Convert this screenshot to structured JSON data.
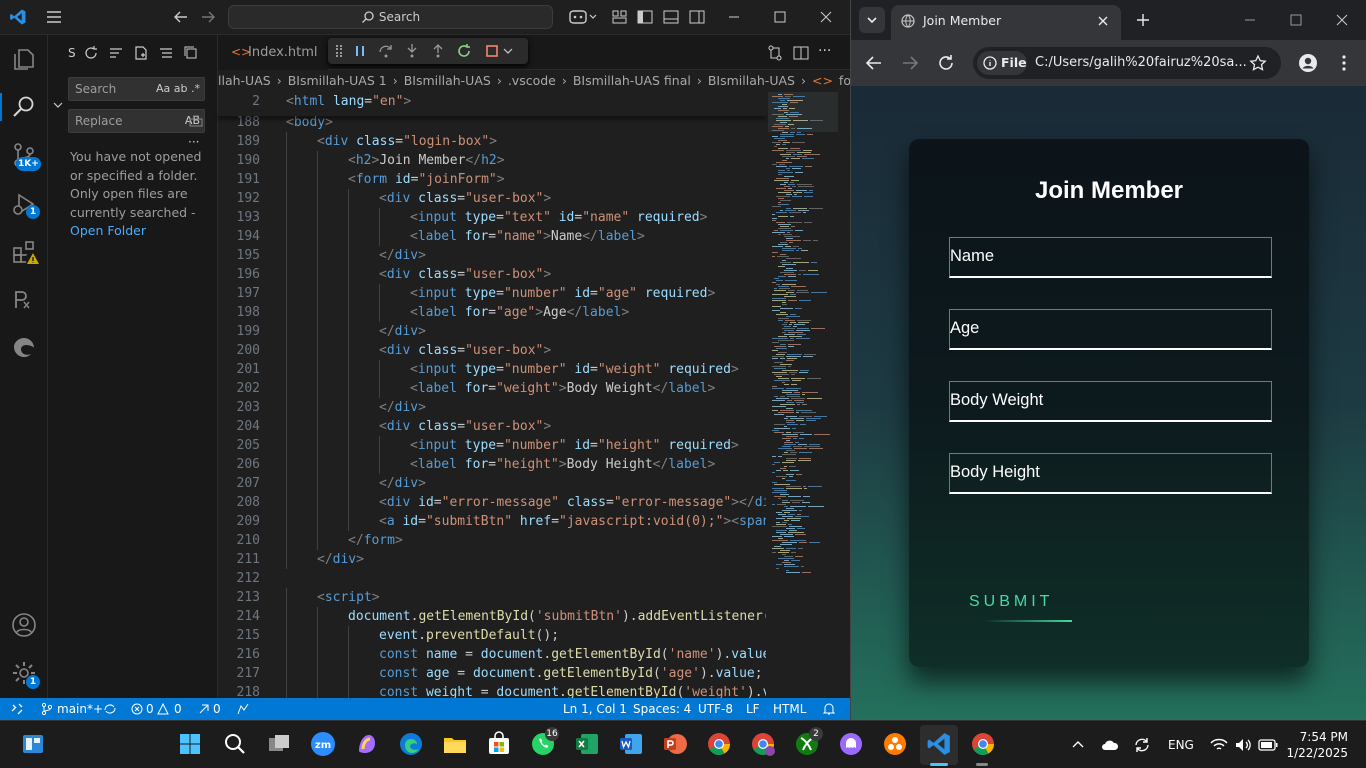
{
  "vscode": {
    "search_label": "Search",
    "sidebar": {
      "title_initial": "S",
      "search_placeholder": "Search",
      "search_opts": "Aa ab .*",
      "replace_placeholder": "Replace",
      "replace_opts": "AB",
      "message": "You have not opened or specified a folder. Only open files are currently searched -",
      "open_folder": "Open Folder"
    },
    "activity": {
      "scm_badge": "1K+",
      "debug_badge": "1",
      "settings_badge": "1"
    },
    "tabs": {
      "index": "Index.html"
    },
    "breadcrumb": [
      "llah-UAS",
      "BIsmillah-UAS 1",
      "BIsmillah-UAS",
      ".vscode",
      "BIsmillah-UAS final",
      "BIsmillah-UAS",
      "form.html"
    ],
    "code_lines": [
      {
        "n": "2",
        "html": "<span class=\"br\">&lt;</span><span class=\"tg\">html</span> <span class=\"at\">lang</span><span class=\"pl\">=</span><span class=\"st\">\"en\"</span><span class=\"br\">&gt;</span>",
        "indent": 0
      },
      {
        "n": "188",
        "html": "<span class=\"br\">&lt;</span><span class=\"tg\">body</span><span class=\"br\">&gt;</span>",
        "indent": 0
      },
      {
        "n": "189",
        "html": "<span class=\"br\">&lt;</span><span class=\"tg\">div</span> <span class=\"at\">class</span><span class=\"pl\">=</span><span class=\"st\">\"login-box\"</span><span class=\"br\">&gt;</span>",
        "indent": 1
      },
      {
        "n": "190",
        "html": "<span class=\"br\">&lt;</span><span class=\"tg\">h2</span><span class=\"br\">&gt;</span><span class=\"pl\">Join Member</span><span class=\"br\">&lt;/</span><span class=\"tg\">h2</span><span class=\"br\">&gt;</span>",
        "indent": 2
      },
      {
        "n": "191",
        "html": "<span class=\"br\">&lt;</span><span class=\"tg\">form</span> <span class=\"at\">id</span><span class=\"pl\">=</span><span class=\"st\">\"joinForm\"</span><span class=\"br\">&gt;</span>",
        "indent": 2
      },
      {
        "n": "192",
        "html": "<span class=\"br\">&lt;</span><span class=\"tg\">div</span> <span class=\"at\">class</span><span class=\"pl\">=</span><span class=\"st\">\"user-box\"</span><span class=\"br\">&gt;</span>",
        "indent": 3
      },
      {
        "n": "193",
        "html": "<span class=\"br\">&lt;</span><span class=\"tg\">input</span> <span class=\"at\">type</span><span class=\"pl\">=</span><span class=\"st\">\"text\"</span> <span class=\"at\">id</span><span class=\"pl\">=</span><span class=\"st\">\"name\"</span> <span class=\"at\">required</span><span class=\"br\">&gt;</span>",
        "indent": 4
      },
      {
        "n": "194",
        "html": "<span class=\"br\">&lt;</span><span class=\"tg\">label</span> <span class=\"at\">for</span><span class=\"pl\">=</span><span class=\"st\">\"name\"</span><span class=\"br\">&gt;</span><span class=\"pl\">Name</span><span class=\"br\">&lt;/</span><span class=\"tg\">label</span><span class=\"br\">&gt;</span>",
        "indent": 4
      },
      {
        "n": "195",
        "html": "<span class=\"br\">&lt;/</span><span class=\"tg\">div</span><span class=\"br\">&gt;</span>",
        "indent": 3
      },
      {
        "n": "196",
        "html": "<span class=\"br\">&lt;</span><span class=\"tg\">div</span> <span class=\"at\">class</span><span class=\"pl\">=</span><span class=\"st\">\"user-box\"</span><span class=\"br\">&gt;</span>",
        "indent": 3
      },
      {
        "n": "197",
        "html": "<span class=\"br\">&lt;</span><span class=\"tg\">input</span> <span class=\"at\">type</span><span class=\"pl\">=</span><span class=\"st\">\"number\"</span> <span class=\"at\">id</span><span class=\"pl\">=</span><span class=\"st\">\"age\"</span> <span class=\"at\">required</span><span class=\"br\">&gt;</span>",
        "indent": 4
      },
      {
        "n": "198",
        "html": "<span class=\"br\">&lt;</span><span class=\"tg\">label</span> <span class=\"at\">for</span><span class=\"pl\">=</span><span class=\"st\">\"age\"</span><span class=\"br\">&gt;</span><span class=\"pl\">Age</span><span class=\"br\">&lt;/</span><span class=\"tg\">label</span><span class=\"br\">&gt;</span>",
        "indent": 4
      },
      {
        "n": "199",
        "html": "<span class=\"br\">&lt;/</span><span class=\"tg\">div</span><span class=\"br\">&gt;</span>",
        "indent": 3
      },
      {
        "n": "200",
        "html": "<span class=\"br\">&lt;</span><span class=\"tg\">div</span> <span class=\"at\">class</span><span class=\"pl\">=</span><span class=\"st\">\"user-box\"</span><span class=\"br\">&gt;</span>",
        "indent": 3
      },
      {
        "n": "201",
        "html": "<span class=\"br\">&lt;</span><span class=\"tg\">input</span> <span class=\"at\">type</span><span class=\"pl\">=</span><span class=\"st\">\"number\"</span> <span class=\"at\">id</span><span class=\"pl\">=</span><span class=\"st\">\"weight\"</span> <span class=\"at\">required</span><span class=\"br\">&gt;</span>",
        "indent": 4
      },
      {
        "n": "202",
        "html": "<span class=\"br\">&lt;</span><span class=\"tg\">label</span> <span class=\"at\">for</span><span class=\"pl\">=</span><span class=\"st\">\"weight\"</span><span class=\"br\">&gt;</span><span class=\"pl\">Body Weight</span><span class=\"br\">&lt;/</span><span class=\"tg\">label</span><span class=\"br\">&gt;</span>",
        "indent": 4
      },
      {
        "n": "203",
        "html": "<span class=\"br\">&lt;/</span><span class=\"tg\">div</span><span class=\"br\">&gt;</span>",
        "indent": 3
      },
      {
        "n": "204",
        "html": "<span class=\"br\">&lt;</span><span class=\"tg\">div</span> <span class=\"at\">class</span><span class=\"pl\">=</span><span class=\"st\">\"user-box\"</span><span class=\"br\">&gt;</span>",
        "indent": 3
      },
      {
        "n": "205",
        "html": "<span class=\"br\">&lt;</span><span class=\"tg\">input</span> <span class=\"at\">type</span><span class=\"pl\">=</span><span class=\"st\">\"number\"</span> <span class=\"at\">id</span><span class=\"pl\">=</span><span class=\"st\">\"height\"</span> <span class=\"at\">required</span><span class=\"br\">&gt;</span>",
        "indent": 4
      },
      {
        "n": "206",
        "html": "<span class=\"br\">&lt;</span><span class=\"tg\">label</span> <span class=\"at\">for</span><span class=\"pl\">=</span><span class=\"st\">\"height\"</span><span class=\"br\">&gt;</span><span class=\"pl\">Body Height</span><span class=\"br\">&lt;/</span><span class=\"tg\">label</span><span class=\"br\">&gt;</span>",
        "indent": 4
      },
      {
        "n": "207",
        "html": "<span class=\"br\">&lt;/</span><span class=\"tg\">div</span><span class=\"br\">&gt;</span>",
        "indent": 3
      },
      {
        "n": "208",
        "html": "<span class=\"br\">&lt;</span><span class=\"tg\">div</span> <span class=\"at\">id</span><span class=\"pl\">=</span><span class=\"st\">\"error-message\"</span> <span class=\"at\">class</span><span class=\"pl\">=</span><span class=\"st\">\"error-message\"</span><span class=\"br\">&gt;&lt;/</span><span class=\"tg\">div</span><span class=\"br\">&gt;</span>",
        "indent": 3
      },
      {
        "n": "209",
        "html": "<span class=\"br\">&lt;</span><span class=\"tg\">a</span> <span class=\"at\">id</span><span class=\"pl\">=</span><span class=\"st\">\"submitBtn\"</span> <span class=\"at\">href</span><span class=\"pl\">=</span><span class=\"st\">\"javascript:void(0);\"</span><span class=\"br\">&gt;&lt;</span><span class=\"tg\">span</span><span class=\"br\">&gt;&lt;/</span><span class=\"tg\">span</span><span class=\"br\">&gt;</span>",
        "indent": 3
      },
      {
        "n": "210",
        "html": "<span class=\"br\">&lt;/</span><span class=\"tg\">form</span><span class=\"br\">&gt;</span>",
        "indent": 2
      },
      {
        "n": "211",
        "html": "<span class=\"br\">&lt;/</span><span class=\"tg\">div</span><span class=\"br\">&gt;</span>",
        "indent": 1
      },
      {
        "n": "212",
        "html": "",
        "indent": 0
      },
      {
        "n": "213",
        "html": "<span class=\"br\">&lt;</span><span class=\"tg\">script</span><span class=\"br\">&gt;</span>",
        "indent": 1
      },
      {
        "n": "214",
        "html": "<span class=\"vr\">document</span><span class=\"pl\">.</span><span class=\"fn\">getElementById</span><span class=\"pl\">(</span><span class=\"st\">'submitBtn'</span><span class=\"pl\">).</span><span class=\"fn\">addEventListener</span><span class=\"pl\">(</span><span class=\"st\">'click'</span>",
        "indent": 2
      },
      {
        "n": "215",
        "html": "<span class=\"vr\">event</span><span class=\"pl\">.</span><span class=\"fn\">preventDefault</span><span class=\"pl\">();</span>",
        "indent": 3
      },
      {
        "n": "216",
        "html": "<span class=\"kw\">const</span> <span class=\"vr\">name</span> <span class=\"pl\">=</span> <span class=\"vr\">document</span><span class=\"pl\">.</span><span class=\"fn\">getElementById</span><span class=\"pl\">(</span><span class=\"st\">'name'</span><span class=\"pl\">).</span><span class=\"vr\">value</span><span class=\"pl\">;</span>",
        "indent": 3
      },
      {
        "n": "217",
        "html": "<span class=\"kw\">const</span> <span class=\"vr\">age</span> <span class=\"pl\">=</span> <span class=\"vr\">document</span><span class=\"pl\">.</span><span class=\"fn\">getElementById</span><span class=\"pl\">(</span><span class=\"st\">'age'</span><span class=\"pl\">).</span><span class=\"vr\">value</span><span class=\"pl\">;</span>",
        "indent": 3
      },
      {
        "n": "218",
        "html": "<span class=\"kw\">const</span> <span class=\"vr\">weight</span> <span class=\"pl\">=</span> <span class=\"vr\">document</span><span class=\"pl\">.</span><span class=\"fn\">getElementById</span><span class=\"pl\">(</span><span class=\"st\">'weight'</span><span class=\"pl\">).</span><span class=\"vr\">value</span><span class=\"pl\">;</span>",
        "indent": 3
      }
    ],
    "status": {
      "branch": "main*+",
      "errors": "0",
      "warnings": "0",
      "ports": "0",
      "position": "Ln 1, Col 1",
      "spaces": "Spaces: 4",
      "encoding": "UTF-8",
      "eol": "LF",
      "language": "HTML"
    }
  },
  "browser": {
    "tab_title": "Join Member",
    "scheme_chip": "File",
    "url": "C:/Users/galih%20fairuz%20sa...",
    "page": {
      "title": "Join Member",
      "fields": [
        "Name",
        "Age",
        "Body Weight",
        "Body Height"
      ],
      "submit": "SUBMIT"
    }
  },
  "taskbar": {
    "whatsapp_badge": "16",
    "xbox_badge": "2",
    "lang": "ENG",
    "time": "7:54 PM",
    "date": "1/22/2025"
  },
  "colors": {
    "vscode_accent": "#0078d4",
    "submit_green": "#46d9a0"
  }
}
